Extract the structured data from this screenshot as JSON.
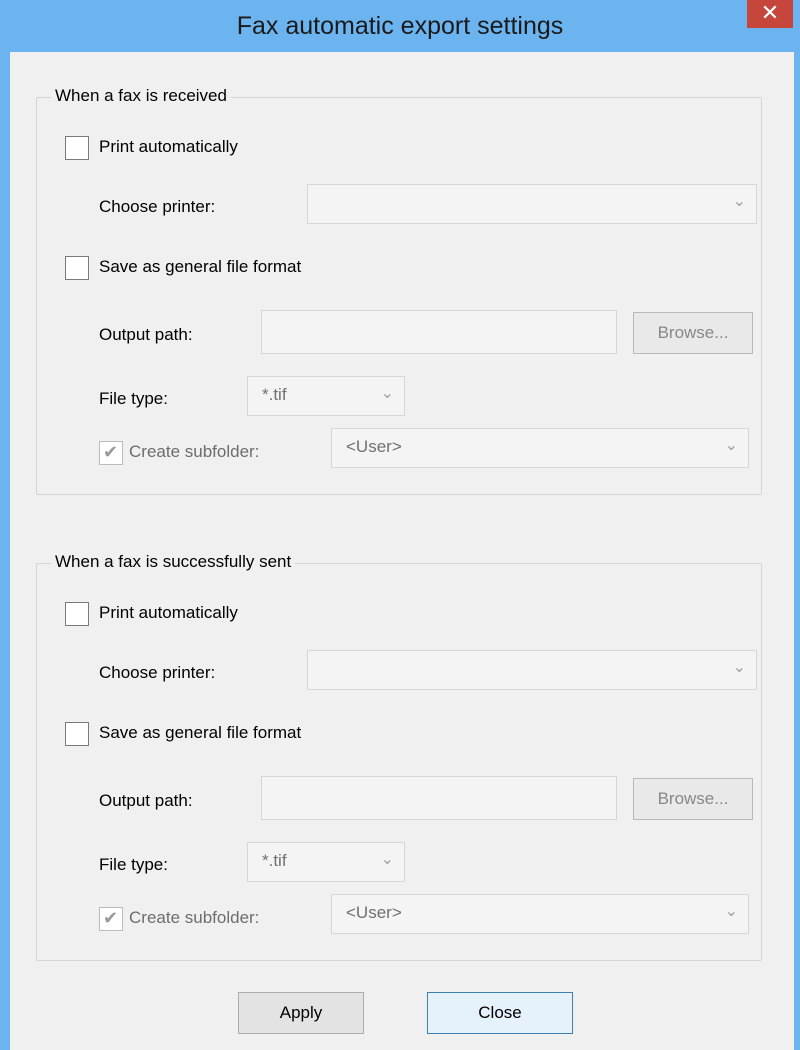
{
  "window": {
    "title": "Fax automatic export settings",
    "close_glyph": "✕"
  },
  "received": {
    "legend": "When a fax is received",
    "print_auto_label": "Print automatically",
    "print_auto_checked": false,
    "choose_printer_label": "Choose printer:",
    "printer_value": "",
    "save_general_label": "Save as general file format",
    "save_general_checked": false,
    "output_path_label": "Output path:",
    "output_path_value": "",
    "browse_label": "Browse...",
    "file_type_label": "File type:",
    "file_type_value": "*.tif",
    "create_subfolder_label": "Create subfolder:",
    "create_subfolder_checked": true,
    "subfolder_value": "<User>"
  },
  "sent": {
    "legend": "When a fax is successfully sent",
    "print_auto_label": "Print automatically",
    "print_auto_checked": false,
    "choose_printer_label": "Choose printer:",
    "printer_value": "",
    "save_general_label": "Save as general file format",
    "save_general_checked": false,
    "output_path_label": "Output path:",
    "output_path_value": "",
    "browse_label": "Browse...",
    "file_type_label": "File type:",
    "file_type_value": "*.tif",
    "create_subfolder_label": "Create subfolder:",
    "create_subfolder_checked": true,
    "subfolder_value": "<User>"
  },
  "footer": {
    "apply_label": "Apply",
    "close_label": "Close"
  },
  "icons": {
    "dropdown_arrow": "chevron-down-icon",
    "checkmark": "checkmark-icon",
    "close": "close-icon"
  },
  "colors": {
    "titlebar": "#6cb4f0",
    "close_button": "#c7463b",
    "dialog_bg": "#f0f0f0",
    "default_button_border": "#3c7fb1"
  }
}
